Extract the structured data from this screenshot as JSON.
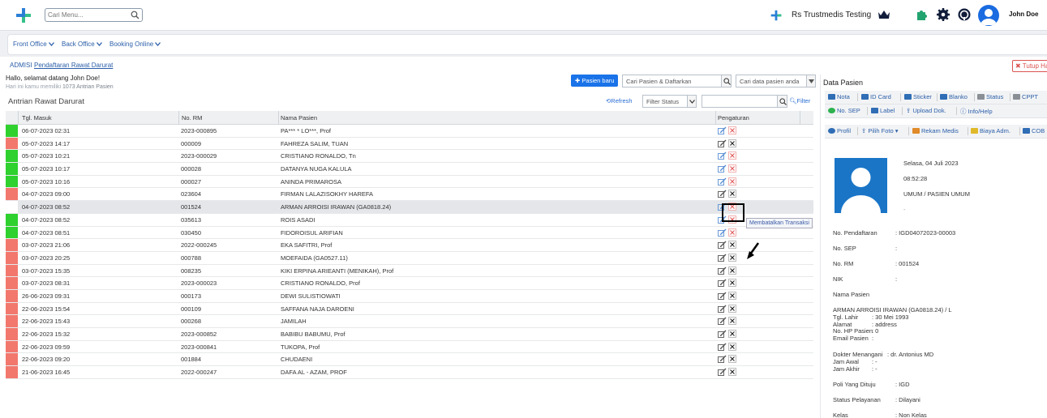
{
  "topbar": {
    "search_placeholder": "Cari Menu...",
    "hospital_name": "Rs Trustmedis Testing",
    "user_name": "John Doe",
    "brand_color": "#1a6be0"
  },
  "menu": [
    "Front Office",
    "Back Office",
    "Booking Online"
  ],
  "breadcrumb": {
    "root": "ADMISI",
    "current": "Pendaftaran Rawat Darurat"
  },
  "close_tab": "Tutup Ha",
  "greeting": {
    "line1": "Hallo, selamat datang John Doe!",
    "line2_prefix": "Hari ini kamu memiliki",
    "line2_count": "1073 Antrian Pasien"
  },
  "toolbar": {
    "new_patient": "Pasien baru",
    "search_register_placeholder": "Cari Pasien & Daftarkan",
    "search_data_placeholder": "Cari data pasien anda"
  },
  "list": {
    "title": "Antrian Rawat Darurat",
    "refresh": "Refresh",
    "filter_status": "Filter Status",
    "filter": "Filter",
    "columns": [
      "Tgl. Masuk",
      "No. RM",
      "Nama Pasien",
      "Pengaturan"
    ],
    "rows": [
      {
        "date": "06-07-2023 02:31",
        "rm": "2023-000895",
        "name": "PA*** * LO***, Prof",
        "status": "green"
      },
      {
        "date": "05-07-2023 14:17",
        "rm": "000009",
        "name": "FAHREZA SALIM, TUAN",
        "status": "red"
      },
      {
        "date": "05-07-2023 10:21",
        "rm": "2023-000029",
        "name": "CRISTIANO RONALDO, Tn",
        "status": "green"
      },
      {
        "date": "05-07-2023 10:17",
        "rm": "000028",
        "name": "DATANYA NUGA KALULA",
        "status": "green"
      },
      {
        "date": "05-07-2023 10:16",
        "rm": "000027",
        "name": "ANINDA PRIMAROSA",
        "status": "green"
      },
      {
        "date": "04-07-2023 09:00",
        "rm": "023604",
        "name": "FIRMAN LALAZISOKHY HAREFA",
        "status": "red"
      },
      {
        "date": "04-07-2023 08:52",
        "rm": "001524",
        "name": "ARMAN ARROISI IRAWAN (GA0818.24)",
        "status": "none",
        "highlight": true
      },
      {
        "date": "04-07-2023 08:52",
        "rm": "035613",
        "name": "ROIS ASADI",
        "status": "green"
      },
      {
        "date": "04-07-2023 08:51",
        "rm": "030450",
        "name": "FIDOROISUL ARIFIAN",
        "status": "green"
      },
      {
        "date": "03-07-2023 21:06",
        "rm": "2022-000245",
        "name": "EKA SAFITRI, Prof",
        "status": "red"
      },
      {
        "date": "03-07-2023 20:25",
        "rm": "000788",
        "name": "MOEFAIDA (GA0527.11)",
        "status": "red"
      },
      {
        "date": "03-07-2023 15:35",
        "rm": "008235",
        "name": "KIKI ERPINA ARIEANTI (MENIKAH), Prof",
        "status": "red"
      },
      {
        "date": "03-07-2023 08:31",
        "rm": "2023-000023",
        "name": "CRISTIANO RONALDO, Prof",
        "status": "red"
      },
      {
        "date": "26-06-2023 09:31",
        "rm": "000173",
        "name": "DEWI SULISTIOWATI",
        "status": "red"
      },
      {
        "date": "22-06-2023 15:54",
        "rm": "000109",
        "name": "SAFFANA NAJA DAROENI",
        "status": "red"
      },
      {
        "date": "22-06-2023 15:43",
        "rm": "000268",
        "name": "JAMILAH",
        "status": "red"
      },
      {
        "date": "22-06-2023 15:32",
        "rm": "2023-000852",
        "name": "BABIBU BABUMU, Prof",
        "status": "red"
      },
      {
        "date": "22-06-2023 09:59",
        "rm": "2023-000841",
        "name": "TUKOPA, Prof",
        "status": "red"
      },
      {
        "date": "22-06-2023 09:20",
        "rm": "001884",
        "name": "CHUDAENI",
        "status": "red"
      },
      {
        "date": "21-06-2023 16:45",
        "rm": "2022-000247",
        "name": "DAFA AL - AZAM, PROF",
        "status": "red"
      }
    ]
  },
  "tooltip": "Membatalkan Transaksi",
  "colors": {
    "green": "#2ed12e",
    "red": "#f2786e",
    "none": "#ffffff"
  },
  "panel": {
    "title": "Data Pasien",
    "bar1": [
      "Nota",
      "ID Card",
      "Sticker",
      "Blanko",
      "Status",
      "CPPT"
    ],
    "bar2": [
      "No. SEP",
      "Label",
      "Upload Dok.",
      "Info/Help"
    ],
    "bar3": [
      "Profil",
      "Pilih Foto",
      "Rekam Medis",
      "Biaya Adm.",
      "COB"
    ],
    "date": "Selasa, 04 Juli 2023",
    "time": "08:52:28",
    "type": "UMUM / PASIEN UMUM",
    "dash": "-",
    "fields": [
      {
        "label": "No. Pendaftaran",
        "value": ": IGD04072023-00003"
      },
      {
        "label": "No. SEP",
        "value": ":"
      },
      {
        "label": "No. RM",
        "value": ": 001524"
      },
      {
        "label": "NIK",
        "value": ":"
      },
      {
        "label": "Nama Pasien",
        "value": ""
      }
    ],
    "patient_name": "ARMAN ARROISI IRAWAN (GA0818.24) / L",
    "details": [
      {
        "label": "Tgl. Lahir",
        "value": ": 30 Mei 1993"
      },
      {
        "label": "Alamat",
        "value": ": address"
      },
      {
        "label": "No. HP Pasien",
        "value": ": 0"
      },
      {
        "label": "Email Pasien",
        "value": ":"
      }
    ],
    "doctor_label": "Dokter Menangani",
    "doctor_value": ": dr. Antonius MD",
    "times": [
      {
        "label": "Jam Awal",
        "value": ": -"
      },
      {
        "label": "Jam Akhir",
        "value": ": -"
      }
    ],
    "bottom": [
      {
        "label": "Poli Yang Dituju",
        "value": ": IGD"
      },
      {
        "label": "Status Pelayanan",
        "value": ": Dilayani"
      },
      {
        "label": "Kelas",
        "value": ": Non Kelas"
      }
    ]
  }
}
